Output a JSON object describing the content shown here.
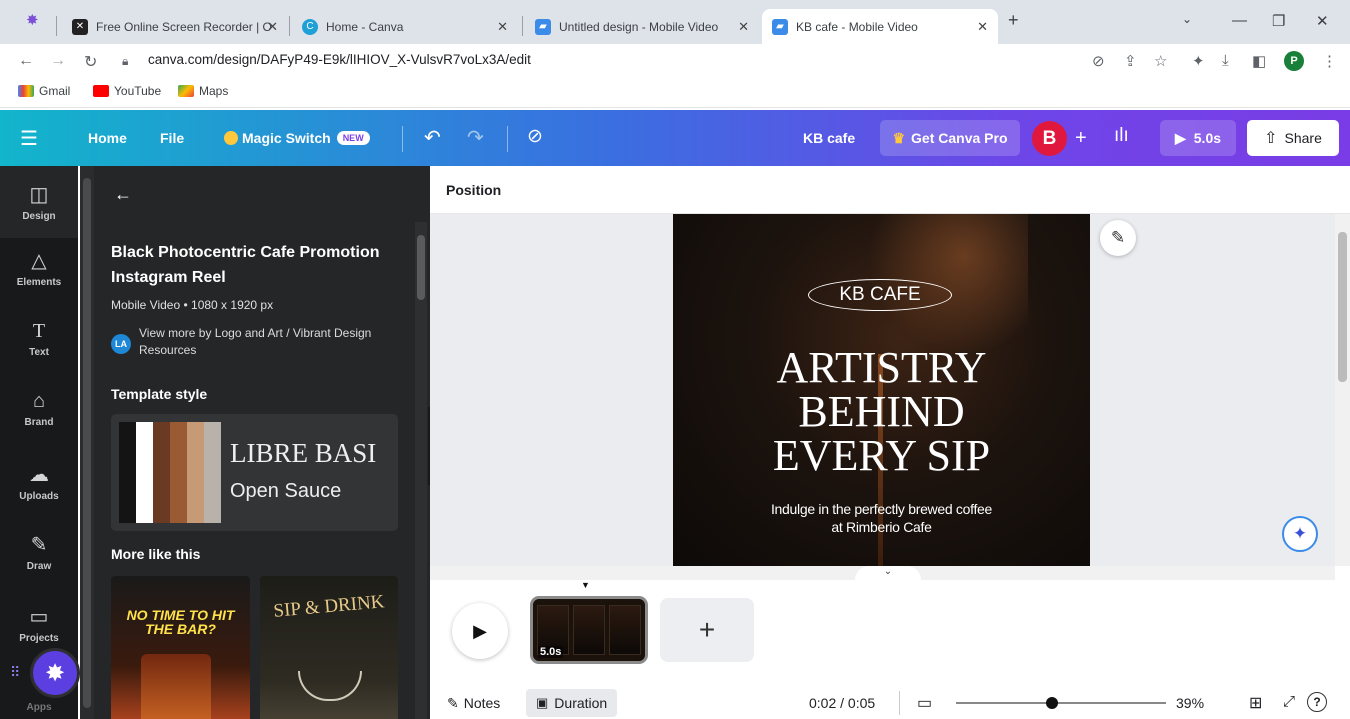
{
  "browser": {
    "tabs": [
      {
        "title": "Free Online Screen Recorder | O"
      },
      {
        "title": "Home - Canva"
      },
      {
        "title": "Untitled design - Mobile Video"
      },
      {
        "title": "KB cafe - Mobile Video"
      }
    ],
    "new_tab": "+",
    "url": "canva.com/design/DAFyP49-E9k/lIHIOV_X-VulsvR7voLx3A/edit",
    "profile_initial": "P",
    "bookmarks": [
      "Gmail",
      "YouTube",
      "Maps"
    ]
  },
  "header": {
    "home": "Home",
    "file": "File",
    "magic_switch": "Magic Switch",
    "new_badge": "NEW",
    "design_title": "KB cafe",
    "get_pro": "Get Canva Pro",
    "avatar": "B",
    "add": "+",
    "duration": "5.0s",
    "share": "Share"
  },
  "rail": {
    "items": [
      {
        "label": "Design"
      },
      {
        "label": "Elements"
      },
      {
        "label": "Text"
      },
      {
        "label": "Brand"
      },
      {
        "label": "Uploads"
      },
      {
        "label": "Draw"
      },
      {
        "label": "Projects"
      },
      {
        "label": "Apps"
      }
    ]
  },
  "panel": {
    "title": "Black Photocentric Cafe Promotion Instagram Reel",
    "meta": "Mobile Video • 1080 x 1920 px",
    "author_initials": "LA",
    "author_text": "View more by Logo and Art / Vibrant Design Resources",
    "template_style_heading": "Template style",
    "font_primary": "LIBRE BASI",
    "font_secondary": "Open Sauce",
    "palette": [
      "#141414",
      "#ffffff",
      "#6a3a22",
      "#9a5a34",
      "#c59a74",
      "#b9b2ab"
    ],
    "more_like_this": "More like this",
    "thumb1_text": "NO TIME TO HIT THE BAR?",
    "thumb2_text": "SIP & DRINK"
  },
  "toolbar": {
    "position": "Position"
  },
  "design": {
    "brand": "KB CAFE",
    "headline": [
      "ARTISTRY",
      "BEHIND",
      "EVERY SIP"
    ],
    "sub": [
      "Indulge in the perfectly brewed coffee",
      "at Rimberio Cafe"
    ]
  },
  "timeline": {
    "clip_duration": "5.0s",
    "add_clip": "+"
  },
  "footer": {
    "notes": "Notes",
    "duration": "Duration",
    "time": "0:02 / 0:05",
    "zoom": "39%",
    "zoom_fraction": 0.39,
    "help": "?"
  }
}
